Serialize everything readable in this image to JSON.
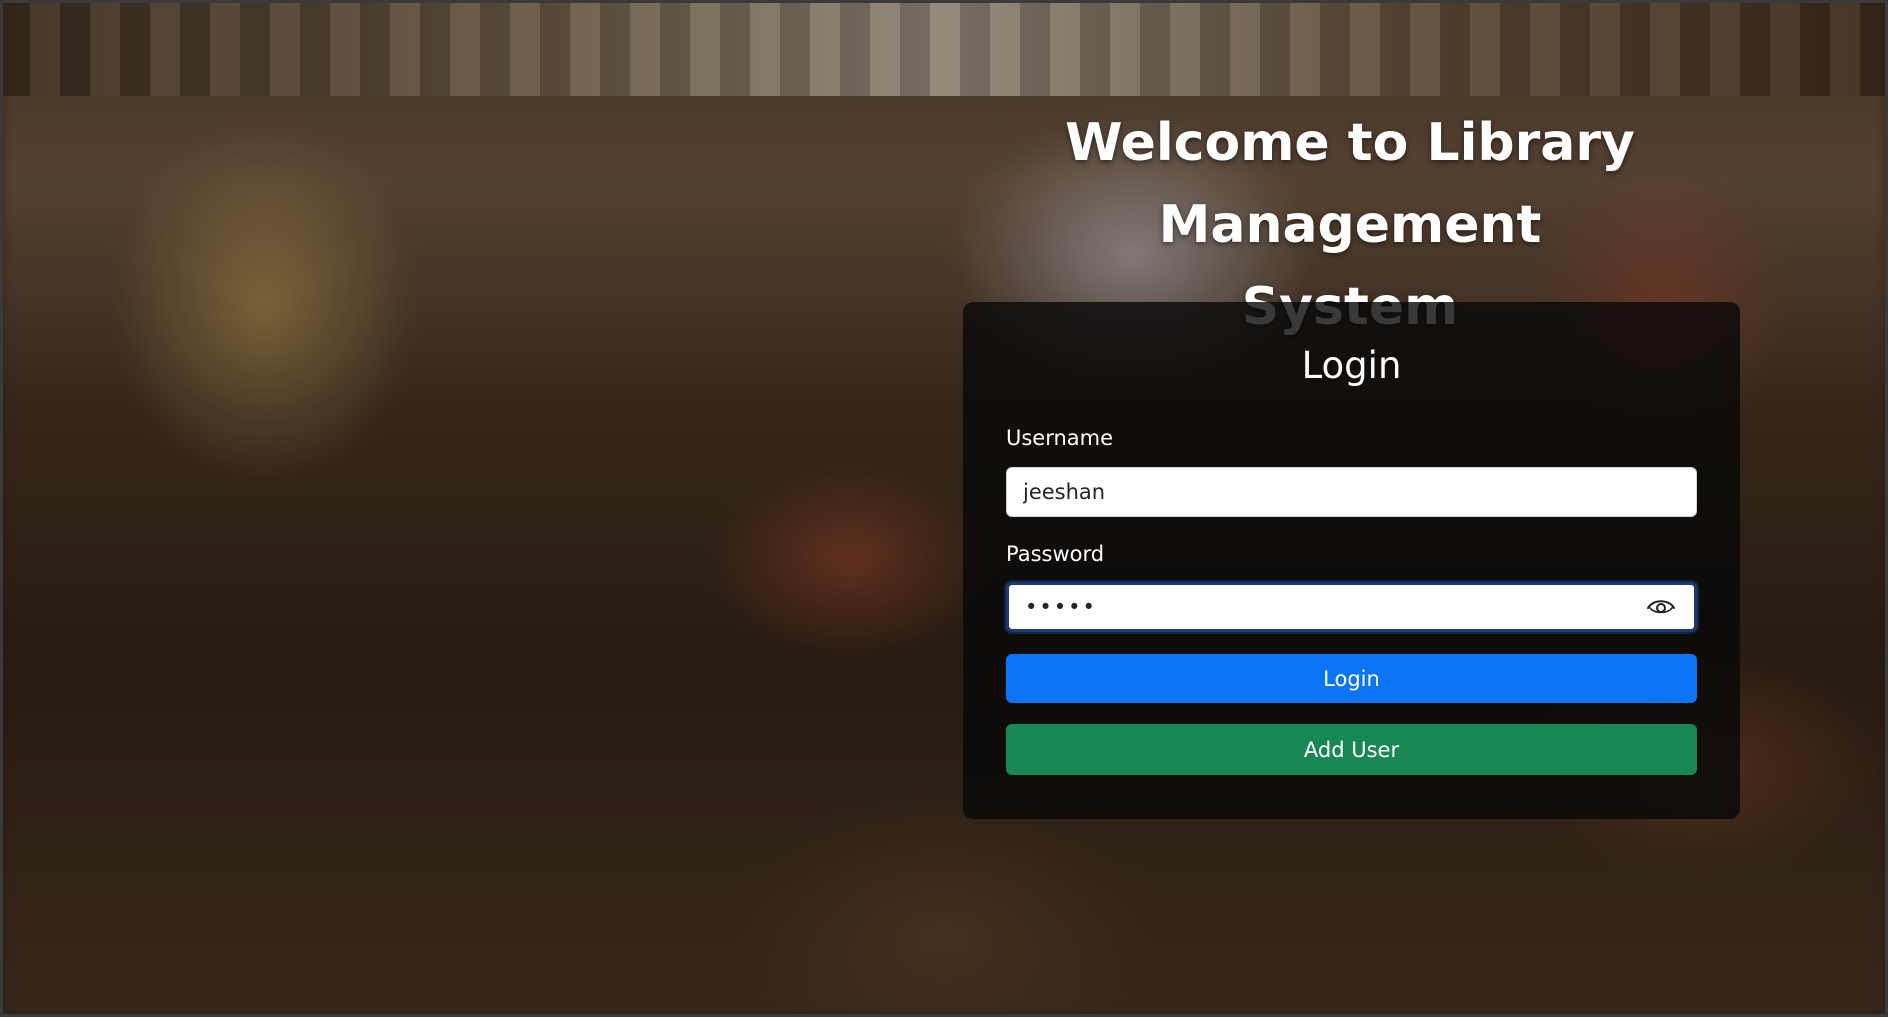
{
  "page": {
    "title_line1": "Welcome to Library",
    "title_line2": "Management System"
  },
  "login_card": {
    "heading": "Login",
    "username_label": "Username",
    "username_value": "jeeshan",
    "password_label": "Password",
    "password_value": "•••••",
    "login_button": "Login",
    "add_user_button": "Add User"
  },
  "colors": {
    "login_button": "#0b74f7",
    "add_user_button": "#198754",
    "card_background": "rgba(8,8,8,0.80)"
  },
  "icons": {
    "password_toggle": "eye-icon"
  }
}
